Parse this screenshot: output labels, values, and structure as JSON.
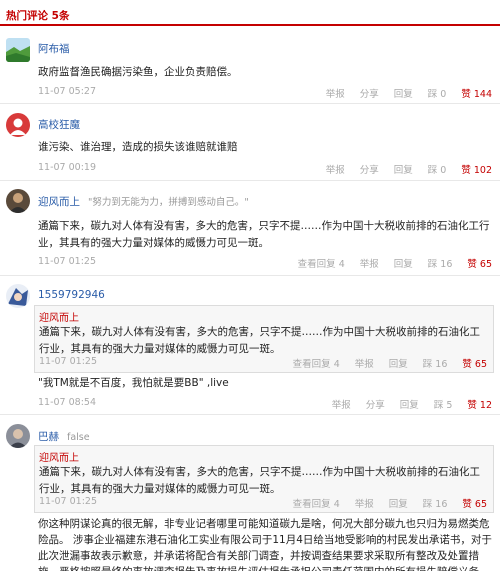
{
  "header": {
    "title": "热门评论 5条"
  },
  "comments": [
    {
      "user": "阿布福",
      "text": "政府监督渔民确据污染鱼，企业负责赔偿。",
      "time": "11-07 05:27",
      "report": "举报",
      "share": "分享",
      "reply": "回复",
      "dislike": "踩 0",
      "like": "赞 144"
    },
    {
      "user": "高校狂魔",
      "text": "谁污染、谁治理，造成的损失该谁赔就谁赔",
      "time": "11-07 00:19",
      "report": "举报",
      "share": "分享",
      "reply": "回复",
      "dislike": "踩 0",
      "like": "赞 102"
    },
    {
      "user": "迎风而上",
      "signature": "\"努力到无能为力，拼搏到感动自己。\"",
      "text": "通篇下来，碳九对人体有没有害，多大的危害，只字不提……作为中国十大税收前排的石油化工行业，其具有的强大力量对媒体的威慑力可见一斑。",
      "time": "11-07 01:25",
      "view_replies": "查看回复 4",
      "report": "举报",
      "reply": "回复",
      "dislike": "踩 16",
      "like": "赞 65"
    },
    {
      "user": "1559792946",
      "quote": {
        "user": "迎风而上",
        "text": "通篇下来，碳九对人体有没有害，多大的危害，只字不提……作为中国十大税收前排的石油化工行业，其具有的强大力量对媒体的威慑力可见一斑。",
        "time": "11-07 01:25",
        "view_replies": "查看回复 4",
        "report": "举报",
        "reply": "回复",
        "dislike": "踩 16",
        "like": "赞 65"
      },
      "text": "\"我TM就是不百度，我怕就是要BB\" ,live",
      "time": "11-07 08:54",
      "report": "举报",
      "share": "分享",
      "reply": "回复",
      "dislike": "踩 5",
      "like": "赞 12"
    },
    {
      "user": "巴赫",
      "signature": "false",
      "quote": {
        "user": "迎风而上",
        "text": "通篇下来，碳九对人体有没有害，多大的危害，只字不提……作为中国十大税收前排的石油化工行业，其具有的强大力量对媒体的威慑力可见一斑。",
        "time": "11-07 01:25",
        "view_replies": "查看回复 4",
        "report": "举报",
        "reply": "回复",
        "dislike": "踩 16",
        "like": "赞 65"
      },
      "text": "你这种阴谋论真的很无解，非专业记者哪里可能知道碳九是啥，何况大部分碳九也只归为易燃类危险品。 涉事企业福建东港石油化工实业有限公司于11月4日给当地受影响的村民发出承诺书，对于此次泄漏事故表示歉意，并承诺将配合有关部门调查，并按调查结果要求采取所有整改及处置措施，严格按照最终的事故调查报告及事故损失评估报告承担公司责任范围内的所有损失赔偿义务。"
    }
  ],
  "colors": {
    "accent": "#c40000",
    "username": "#2a5ca8",
    "meta": "#aaaaaa"
  }
}
